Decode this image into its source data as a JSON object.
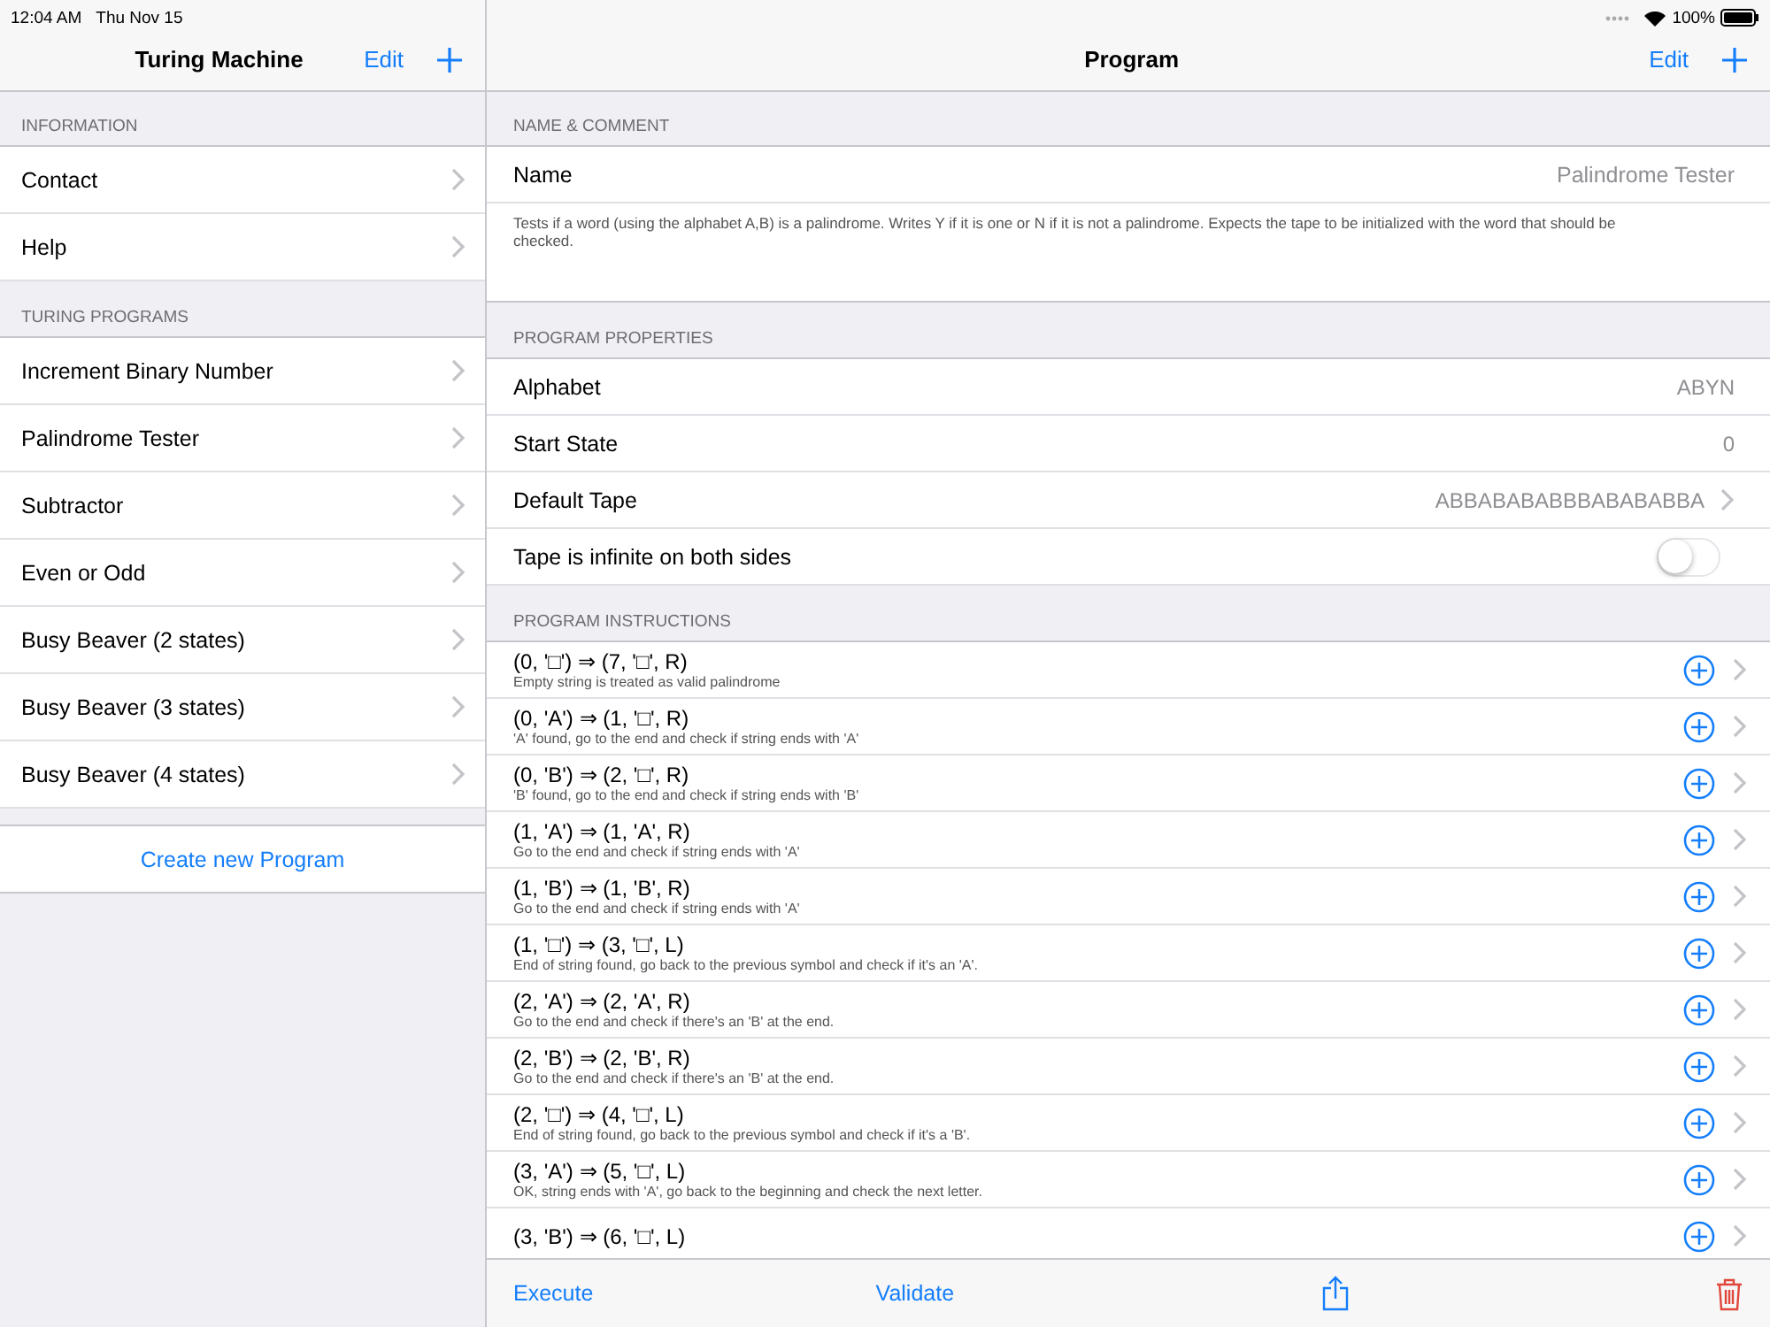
{
  "status_bar": {
    "time": "12:04 AM",
    "date": "Thu Nov 15",
    "battery": "100%"
  },
  "sidebar": {
    "title": "Turing Machine",
    "edit": "Edit",
    "sections": [
      {
        "header": "INFORMATION",
        "items": [
          {
            "label": "Contact"
          },
          {
            "label": "Help"
          }
        ]
      },
      {
        "header": "TURING PROGRAMS",
        "items": [
          {
            "label": "Increment Binary Number"
          },
          {
            "label": "Palindrome Tester"
          },
          {
            "label": "Subtractor"
          },
          {
            "label": "Even or Odd"
          },
          {
            "label": "Busy Beaver (2 states)"
          },
          {
            "label": "Busy Beaver (3 states)"
          },
          {
            "label": "Busy Beaver (4 states)"
          }
        ]
      }
    ],
    "create_button": "Create new Program"
  },
  "detail": {
    "title": "Program",
    "edit": "Edit",
    "name_section": {
      "header": "NAME & COMMENT",
      "name_label": "Name",
      "name_value": "Palindrome Tester",
      "comment": "Tests if a word (using the alphabet A,B) is a palindrome. Writes Y if it is one or N if it is not a palindrome. Expects the tape to be initialized with the word that should be checked."
    },
    "properties_header": "PROGRAM PROPERTIES",
    "properties": [
      {
        "kind": "value",
        "label": "Alphabet",
        "value": "ABYN"
      },
      {
        "kind": "value",
        "label": "Start State",
        "value": "0"
      },
      {
        "kind": "link",
        "label": "Default Tape",
        "value": "ABBABABABBBABABABBA"
      },
      {
        "kind": "toggle",
        "label": "Tape is infinite on both sides",
        "on": false
      }
    ],
    "instructions_header": "PROGRAM INSTRUCTIONS",
    "instructions": [
      {
        "rule": "(0, '□') ⇒ (7, '□', R)",
        "comment": "Empty string is treated as valid palindrome"
      },
      {
        "rule": "(0, 'A') ⇒ (1, '□', R)",
        "comment": "'A' found, go to the end and check if string ends with 'A'"
      },
      {
        "rule": "(0, 'B') ⇒ (2, '□', R)",
        "comment": "'B' found, go to the end and check if string ends with 'B'"
      },
      {
        "rule": "(1, 'A') ⇒ (1, 'A', R)",
        "comment": "Go to the end and check if string ends with 'A'"
      },
      {
        "rule": "(1, 'B') ⇒ (1, 'B', R)",
        "comment": "Go to the end and check if string ends with 'A'"
      },
      {
        "rule": "(1, '□') ⇒ (3, '□', L)",
        "comment": "End of string found, go back to the previous symbol and check if it's an 'A'."
      },
      {
        "rule": "(2, 'A') ⇒ (2, 'A', R)",
        "comment": "Go to the end and check if there's an 'B' at the end."
      },
      {
        "rule": "(2, 'B') ⇒ (2, 'B', R)",
        "comment": "Go to the end and check if there's an 'B' at the end."
      },
      {
        "rule": "(2, '□') ⇒ (4, '□', L)",
        "comment": "End of string found, go back to the previous symbol and check if it's a 'B'."
      },
      {
        "rule": "(3, 'A') ⇒ (5, '□', L)",
        "comment": "OK, string ends with 'A', go back to the beginning and check the next letter."
      },
      {
        "rule": "(3, 'B') ⇒ (6, '□', L)"
      }
    ],
    "toolbar": {
      "execute": "Execute",
      "validate": "Validate"
    }
  }
}
